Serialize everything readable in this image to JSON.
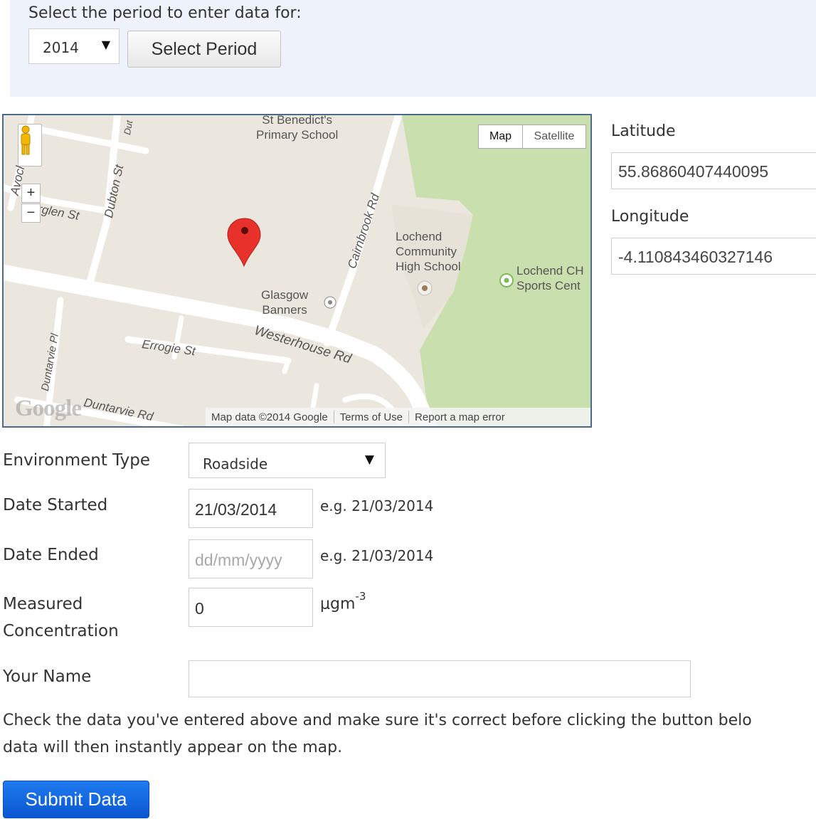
{
  "period": {
    "heading": "Select the period to enter data for:",
    "year_value": "2014",
    "select_button": "Select Period"
  },
  "map": {
    "type_buttons": {
      "map": "Map",
      "satellite": "Satellite"
    },
    "places": {
      "school_top": "St Benedict's\nPrimary School",
      "lochend": "Lochend\nCommunity\nHigh School",
      "sports": "Lochend CH\nSports Cent",
      "glasgow_banners": "Glasgow\nBanners"
    },
    "streets": {
      "avoch": "Avoch Dr",
      "dubton": "Dubton St",
      "glen": "rglen St",
      "cairnbrook": "Cairnbrook Rd",
      "westerhouse": "Westerhouse Rd",
      "errogie": "Errogie St",
      "duntarvie_pl": "Duntarvie Pl",
      "duntarvie_rd": "Duntarvie Rd",
      "dut": "Dut"
    },
    "logo": "Google",
    "attribution": {
      "data": "Map data ©2014 Google",
      "terms": "Terms of Use",
      "report": "Report a map error"
    },
    "zoom_in": "+",
    "zoom_out": "−"
  },
  "coordinates": {
    "latitude_label": "Latitude",
    "latitude_value": "55.86860407440095",
    "longitude_label": "Longitude",
    "longitude_value": "-4.110843460327146"
  },
  "form": {
    "environment_label": "Environment Type",
    "environment_value": "Roadside",
    "date_started_label": "Date Started",
    "date_started_value": "21/03/2014",
    "date_started_hint": "e.g. 21/03/2014",
    "date_ended_label": "Date Ended",
    "date_ended_placeholder": "dd/mm/yyyy",
    "date_ended_hint": "e.g. 21/03/2014",
    "concentration_label_1": "Measured",
    "concentration_label_2": "Concentration",
    "concentration_value": "0",
    "concentration_unit": "μgm",
    "concentration_unit_exp": "-3",
    "name_label": "Your Name",
    "name_value": ""
  },
  "notice": {
    "line1": "Check the data you've entered above and make sure it's correct before clicking the button belo",
    "line2": "data will then instantly appear on the map."
  },
  "submit": {
    "label": "Submit Data"
  },
  "colors": {
    "panel_bg": "#eef3fb",
    "map_land": "#ebe7df",
    "map_park": "#c9dfae",
    "marker": "#e8312a",
    "submit": "#1a6fe6"
  }
}
